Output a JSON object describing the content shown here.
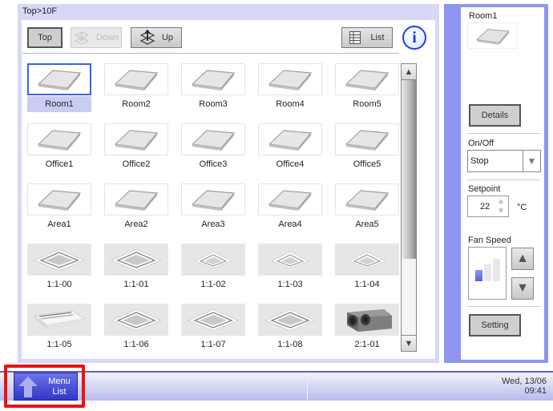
{
  "breadcrumb": "Top>10F",
  "toolbar": {
    "top_label": "Top",
    "down_label": "Down",
    "up_label": "Up",
    "list_label": "List",
    "info_icon": "info-icon"
  },
  "grid": {
    "selected": "Room1",
    "tiles": [
      {
        "label": "Room1",
        "type": "zone"
      },
      {
        "label": "Room2",
        "type": "zone"
      },
      {
        "label": "Room3",
        "type": "zone"
      },
      {
        "label": "Room4",
        "type": "zone"
      },
      {
        "label": "Room5",
        "type": "zone"
      },
      {
        "label": "Office1",
        "type": "zone"
      },
      {
        "label": "Office2",
        "type": "zone"
      },
      {
        "label": "Office3",
        "type": "zone"
      },
      {
        "label": "Office4",
        "type": "zone"
      },
      {
        "label": "Office5",
        "type": "zone"
      },
      {
        "label": "Area1",
        "type": "zone"
      },
      {
        "label": "Area2",
        "type": "zone"
      },
      {
        "label": "Area3",
        "type": "zone"
      },
      {
        "label": "Area4",
        "type": "zone"
      },
      {
        "label": "Area5",
        "type": "zone"
      },
      {
        "label": "1:1-00",
        "type": "cassette"
      },
      {
        "label": "1:1-01",
        "type": "cassette"
      },
      {
        "label": "1:1-02",
        "type": "cassette-small"
      },
      {
        "label": "1:1-03",
        "type": "cassette-small"
      },
      {
        "label": "1:1-04",
        "type": "cassette-small"
      },
      {
        "label": "1:1-05",
        "type": "ceiling-suspended"
      },
      {
        "label": "1:1-06",
        "type": "cassette"
      },
      {
        "label": "1:1-07",
        "type": "cassette"
      },
      {
        "label": "1:1-08",
        "type": "cassette"
      },
      {
        "label": "2:1-01",
        "type": "ducted"
      }
    ]
  },
  "scrollbar": {
    "position_fraction": 0.0,
    "visible_fraction": 0.7
  },
  "right_panel": {
    "title": "Room1",
    "details_label": "Details",
    "onoff_label": "On/Off",
    "onoff_value": "Stop",
    "setpoint_label": "Setpoint",
    "setpoint_value": "22",
    "setpoint_unit": "°C",
    "fan_speed_label": "Fan Speed",
    "fan_speed_level": 1,
    "fan_speed_levels": 3,
    "setting_label": "Setting"
  },
  "bottom_bar": {
    "menu_label_line1": "Menu",
    "menu_label_line2": "List",
    "date": "Wed, 13/06",
    "time": "09:41"
  },
  "colors": {
    "accent": "#3a62e6",
    "panel_bg": "#d6d8f6",
    "right_panel_bg": "#8e95f0",
    "menu_button": "#2f37c8",
    "highlight": "#ee1111",
    "fan_active": "#5060e8"
  }
}
